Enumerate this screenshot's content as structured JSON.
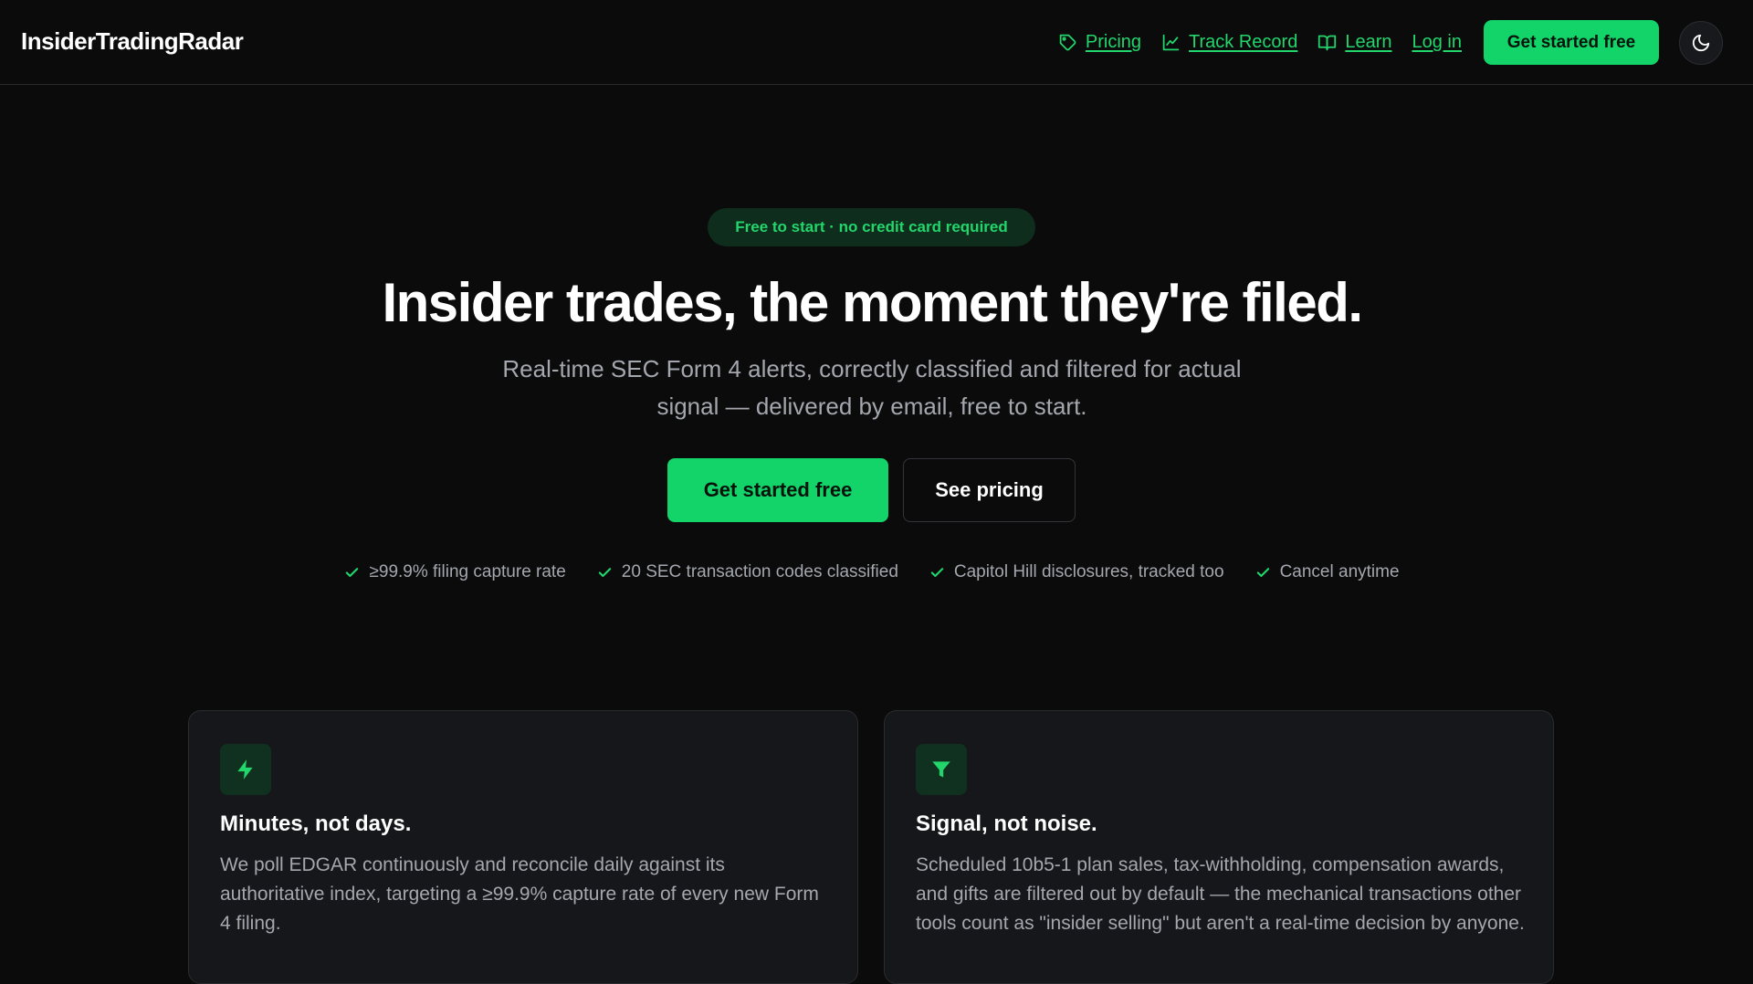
{
  "header": {
    "brand": "InsiderTradingRadar",
    "nav": [
      {
        "label": "Pricing",
        "icon": "tag-icon"
      },
      {
        "label": "Track Record",
        "icon": "line-chart-icon"
      },
      {
        "label": "Learn",
        "icon": "book-icon"
      },
      {
        "label": "Log in",
        "icon": ""
      }
    ],
    "cta_label": "Get started free",
    "theme_toggle_icon": "moon-icon"
  },
  "hero": {
    "badge": "Free to start · no credit card required",
    "title": "Insider trades, the moment they're filed.",
    "subtitle_line1": "Real-time SEC Form 4 alerts, correctly classified and filtered for actual",
    "subtitle_line2": "signal — delivered by email, free to start.",
    "primary_button": "Get started free",
    "secondary_button": "See pricing",
    "checks": [
      "≥99.9% filing capture rate",
      "20 SEC transaction codes classified",
      "Capitol Hill disclosures, tracked too",
      "Cancel anytime"
    ]
  },
  "features": [
    {
      "icon": "lightning-icon",
      "title": "Minutes, not days.",
      "body": "We poll EDGAR continuously and reconcile daily against its authoritative index, targeting a ≥99.9% capture rate of every new Form 4 filing."
    },
    {
      "icon": "filter-icon",
      "title": "Signal, not noise.",
      "body": "Scheduled 10b5-1 plan sales, tax-withholding, compensation awards, and gifts are filtered out by default — the mechanical transactions other tools count as \"insider selling\" but aren't a real-time decision by anyone."
    }
  ],
  "colors": {
    "accent": "#12d468",
    "link": "#22d66b",
    "background": "#0b0b0c",
    "card": "#16171a",
    "muted_text": "#a4a7ad"
  }
}
